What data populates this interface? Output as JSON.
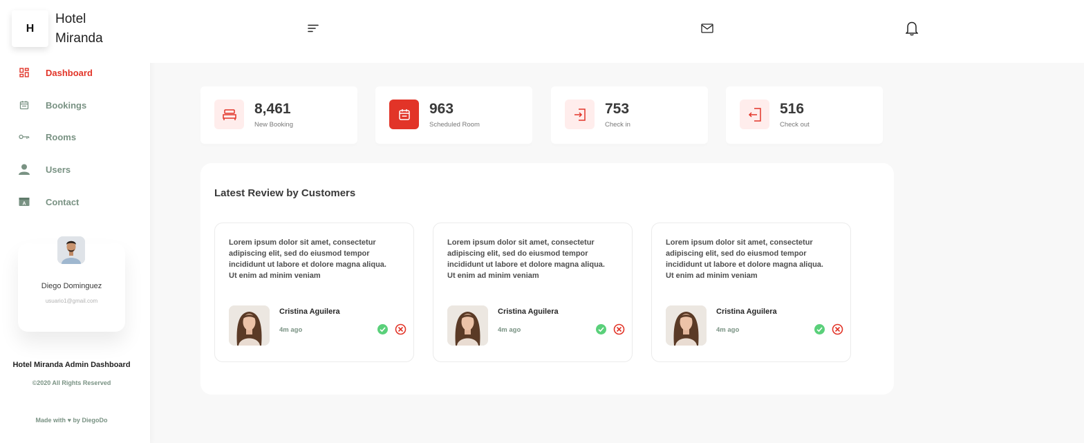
{
  "brand": {
    "logo_letter": "H",
    "name": "Hotel Miranda"
  },
  "sidebar": {
    "items": [
      {
        "label": "Dashboard",
        "icon": "dashboard-icon",
        "active": true
      },
      {
        "label": "Bookings",
        "icon": "calendar-icon",
        "active": false
      },
      {
        "label": "Rooms",
        "icon": "key-icon",
        "active": false
      },
      {
        "label": "Users",
        "icon": "user-icon",
        "active": false
      },
      {
        "label": "Contact",
        "icon": "contact-icon",
        "active": false
      }
    ],
    "user": {
      "name": "Diego Dominguez",
      "email": "usuario1@gmail.com"
    },
    "footer": {
      "title": "Hotel Miranda Admin Dashboard",
      "rights": "©2020 All Rights Reserved",
      "made_prefix": "Made with",
      "made_suffix": "by DiegoDo"
    }
  },
  "topbar": {
    "icons": [
      "menu-icon",
      "mail-icon",
      "bell-icon"
    ]
  },
  "kpis": [
    {
      "value": "8,461",
      "label": "New Booking",
      "icon": "bed-icon"
    },
    {
      "value": "963",
      "label": "Scheduled Room",
      "icon": "calendar-icon"
    },
    {
      "value": "753",
      "label": "Check in",
      "icon": "login-icon"
    },
    {
      "value": "516",
      "label": "Check out",
      "icon": "logout-icon"
    }
  ],
  "reviews": {
    "title": "Latest Review by Customers",
    "items": [
      {
        "text": "Lorem ipsum dolor sit amet, consectetur adipiscing elit, sed do eiusmod tempor incididunt ut labore et dolore magna aliqua. Ut enim ad minim veniam",
        "name": "Cristina Aguilera",
        "time": "4m ago"
      },
      {
        "text": "Lorem ipsum dolor sit amet, consectetur adipiscing elit, sed do eiusmod tempor incididunt ut labore et dolore magna aliqua. Ut enim ad minim veniam",
        "name": "Cristina Aguilera",
        "time": "4m ago"
      },
      {
        "text": "Lorem ipsum dolor sit amet, consectetur adipiscing elit, sed do eiusmod tempor incididunt ut labore et dolore magna aliqua. Ut enim ad minim veniam",
        "name": "Cristina Aguilera",
        "time": "4m ago"
      }
    ]
  },
  "colors": {
    "accent": "#e23428",
    "muted": "#799283",
    "approve": "#5ad07a"
  }
}
